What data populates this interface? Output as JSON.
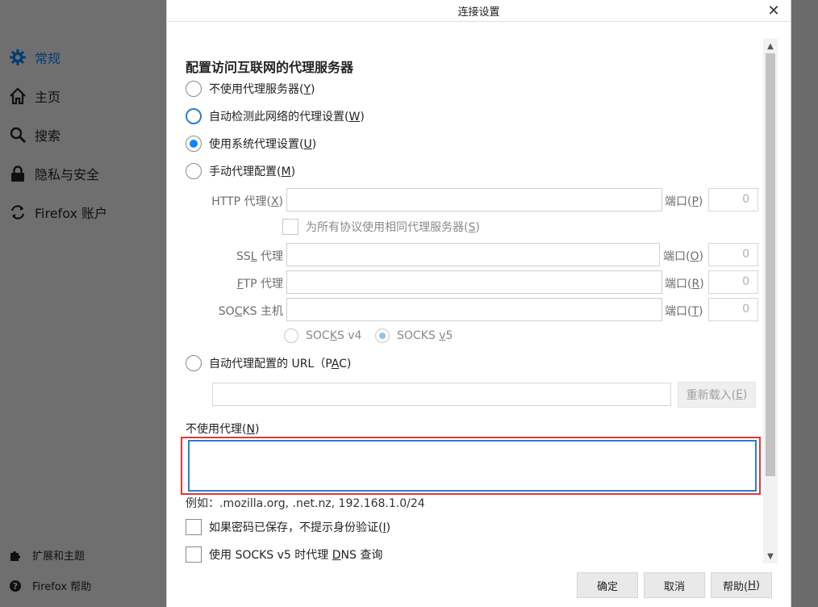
{
  "sidebar": {
    "items": [
      {
        "label": "常规",
        "icon": "gear-icon",
        "active": true
      },
      {
        "label": "主页",
        "icon": "home-icon"
      },
      {
        "label": "搜索",
        "icon": "search-icon"
      },
      {
        "label": "隐私与安全",
        "icon": "lock-icon"
      },
      {
        "label": "Firefox 账户",
        "icon": "sync-icon"
      }
    ],
    "footer": [
      {
        "label": "扩展和主题",
        "icon": "puzzle-icon"
      },
      {
        "label": "Firefox 帮助",
        "icon": "help-icon"
      }
    ]
  },
  "dialog": {
    "title": "连接设置",
    "close_glyph": "✕",
    "heading": "配置访问互联网的代理服务器",
    "options": {
      "no_proxy": {
        "text": "不使用代理服务器(",
        "key": "Y",
        "end": ")"
      },
      "auto_detect": {
        "text": "自动检测此网络的代理设置(",
        "key": "W",
        "end": ")"
      },
      "system": {
        "text": "使用系统代理设置(",
        "key": "U",
        "end": ")"
      },
      "manual": {
        "text": "手动代理配置(",
        "key": "M",
        "end": ")"
      },
      "pac": {
        "text": "自动代理配置的 URL（P",
        "key": "A",
        "end": "C)"
      }
    },
    "selected_option": "使用系统代理设置(U)",
    "manual": {
      "http": {
        "pre": "HTTP 代理(",
        "key": "X",
        "post": ")",
        "value": "",
        "port_pre": "端口(",
        "port_key": "P",
        "port_post": ")",
        "port": "0"
      },
      "share": {
        "pre": "为所有协议使用相同代理服务器(",
        "key": "S",
        "post": ")"
      },
      "ssl": {
        "pre": "SS",
        "key": "L",
        "post": " 代理",
        "value": "",
        "port_pre": "端口(",
        "port_key": "O",
        "port_post": ")",
        "port": "0"
      },
      "ftp": {
        "pre": "",
        "key": "F",
        "post": "TP 代理",
        "value": "",
        "port_pre": "端口(",
        "port_key": "R",
        "port_post": ")",
        "port": "0"
      },
      "socks": {
        "pre": "SO",
        "key": "C",
        "post": "KS 主机",
        "value": "",
        "port_pre": "端口(",
        "port_key": "T",
        "port_post": ")",
        "port": "0"
      },
      "socks_v4": {
        "pre": "SOC",
        "key": "K",
        "post": "S v4"
      },
      "socks_v5": {
        "pre": "SOCKS ",
        "key": "v",
        "post": "5"
      },
      "socks_selected": "SOCKS v5"
    },
    "pac": {
      "url": "",
      "reload_pre": "重新载入(",
      "reload_key": "E",
      "reload_post": ")"
    },
    "no_proxy_for": {
      "pre": "不使用代理(",
      "key": "N",
      "post": ")",
      "value": ""
    },
    "example": "例如：.mozilla.org, .net.nz, 192.168.1.0/24",
    "checkbox_auth": {
      "pre": "如果密码已保存，不提示身份验证(",
      "key": "I",
      "post": ")",
      "checked": false
    },
    "checkbox_dns": {
      "pre": "使用 SOCKS v5 时代理 ",
      "key": "D",
      "post": "NS 查询",
      "checked": false
    },
    "buttons": {
      "ok": "确定",
      "cancel": "取消",
      "help_pre": "帮助(",
      "help_key": "H",
      "help_post": ")"
    },
    "colors": {
      "accent": "#0a84ff",
      "focus_border": "#2b7ec9",
      "highlight_outline": "#e0373d"
    }
  }
}
